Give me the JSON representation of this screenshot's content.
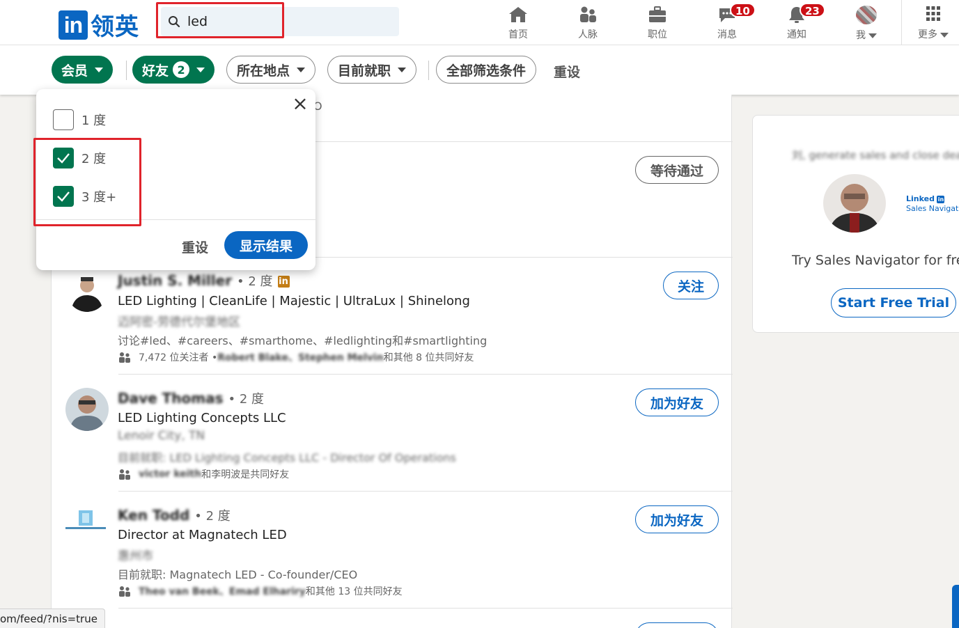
{
  "nav": {
    "logo_text": "领英",
    "logo_in": "in",
    "search_value": "led",
    "items": [
      {
        "label": "首页",
        "icon": "home-icon"
      },
      {
        "label": "人脉",
        "icon": "people-icon"
      },
      {
        "label": "职位",
        "icon": "briefcase-icon"
      },
      {
        "label": "消息",
        "icon": "message-icon",
        "badge": "10"
      },
      {
        "label": "通知",
        "icon": "bell-icon",
        "badge": "23"
      },
      {
        "label": "我",
        "icon": "avatar"
      },
      {
        "label": "更多",
        "icon": "grid-icon"
      }
    ]
  },
  "filters": {
    "member": "会员",
    "connections": "好友",
    "connections_count": "2",
    "location": "所在地点",
    "current_company": "目前就职",
    "all_filters": "全部筛选条件",
    "reset": "重设"
  },
  "dropdown": {
    "options": [
      {
        "label": "1 度",
        "checked": false
      },
      {
        "label": "2 度",
        "checked": true
      },
      {
        "label": "3 度+",
        "checked": true
      }
    ],
    "reset": "重设",
    "show_results": "显示结果"
  },
  "results": {
    "partial_text": "O",
    "pending_label": "等待通过",
    "people": [
      {
        "name": "Justin S. Miller",
        "degree": "• 2 度",
        "headline": "LED Lighting | CleanLife | Majestic | UltraLux | Shinelong",
        "location": "迈阿密-劳德代尔堡地区",
        "meta": "讨论#led、#careers、#smarthome、#ledlighting和#smartlighting",
        "followers": "7,472 位关注者 • ",
        "mutual": "Robert Blake、Stephen Melvin",
        "mutual_suffix": "和其他 8 位共同好友",
        "action": "关注"
      },
      {
        "name": "Dave Thomas",
        "degree": "• 2 度",
        "headline": "LED Lighting Concepts LLC",
        "location": "Lenoir City, TN",
        "meta": "目前就职: LED Lighting Concepts LLC - Director Of Operations",
        "mutual": "victor keith",
        "mutual_suffix": "和李明波是共同好友",
        "action": "加为好友"
      },
      {
        "name": "Ken Todd",
        "degree": "• 2 度",
        "headline": "Director at Magnatech LED",
        "location": "惠州市",
        "meta": "目前就职: Magnatech LED - Co-founder/CEO",
        "mutual": "Theo van Beek、Emad Elhariry",
        "mutual_suffix": "和其他 13 位共同好友",
        "action": "加为好友"
      }
    ]
  },
  "side": {
    "intro": "刘, generate sales and close deals",
    "sn_logo_line1": "Linked",
    "sn_logo_line2": "Sales Navigator",
    "try_text": "Try Sales Navigator for free",
    "trial_button": "Start Free Trial"
  },
  "statusbar": "om/feed/?nis=true",
  "colors": {
    "brand": "#0a66c2",
    "green": "#01754f",
    "badge": "#cc1016",
    "highlight": "#e0232b"
  }
}
